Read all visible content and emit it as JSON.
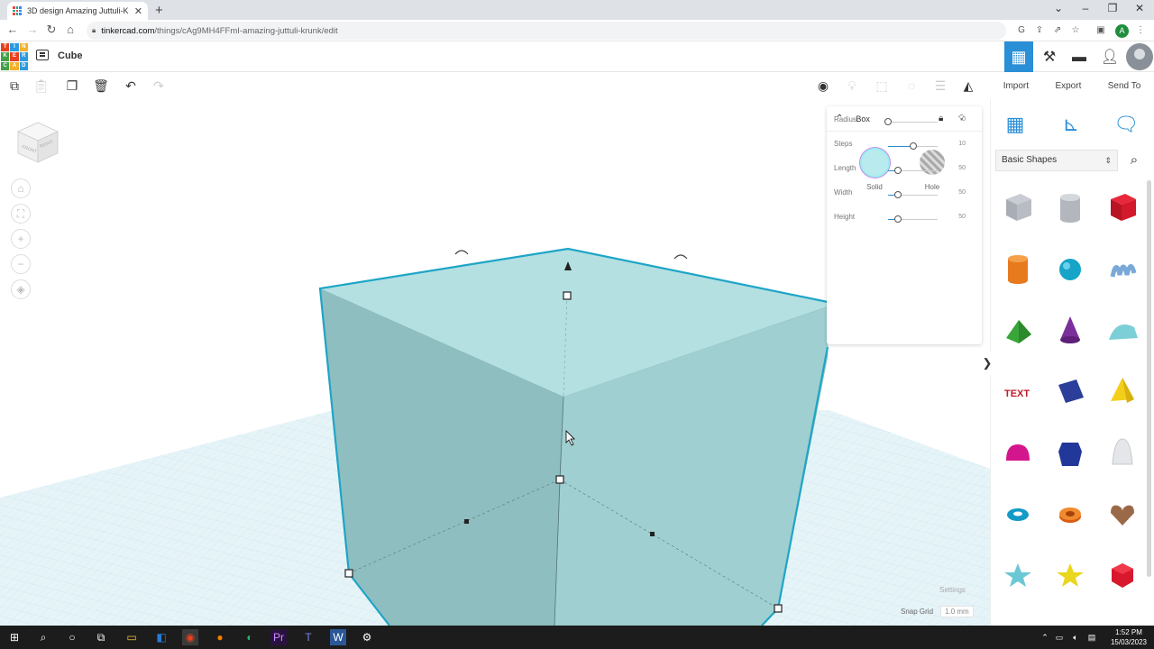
{
  "browser": {
    "tab_title": "3D design Amazing Juttuli-Krunk",
    "tab_close": "✕",
    "new_tab": "+",
    "url_host": "tinkercad.com",
    "url_path": "/things/cAg9MH4FFmI-amazing-juttuli-krunk/edit",
    "profile_initial": "A"
  },
  "header": {
    "logo_letters": [
      "T",
      "I",
      "N",
      "K",
      "E",
      "R",
      "C",
      "A",
      "D"
    ],
    "logo_colors": [
      "#e8411f",
      "#2b9be0",
      "#f3b12b",
      "#43a047",
      "#e8411f",
      "#2b9be0",
      "#43a047",
      "#f3b12b",
      "#2b9be0"
    ],
    "doc_title": "Cube"
  },
  "toolbar": {
    "import_label": "Import",
    "export_label": "Export",
    "sendto_label": "Send To"
  },
  "viewcube": {
    "front_label": "FRONT",
    "right_label": "RIGHT"
  },
  "inspector": {
    "shape_name": "Box",
    "solid_label": "Solid",
    "hole_label": "Hole",
    "solid_color": "#b9ebee",
    "params": [
      {
        "label": "Radius",
        "value": "0",
        "fraction": 0.0
      },
      {
        "label": "Steps",
        "value": "10",
        "fraction": 0.5
      },
      {
        "label": "Length",
        "value": "50",
        "fraction": 0.2
      },
      {
        "label": "Width",
        "value": "50",
        "fraction": 0.2
      },
      {
        "label": "Height",
        "value": "50",
        "fraction": 0.2
      }
    ]
  },
  "library": {
    "selected": "Basic Shapes",
    "shapes": [
      "box-gray",
      "cylinder-gray",
      "box-red",
      "cylinder-orange",
      "sphere-blue",
      "scribble-blue",
      "roof-green",
      "cone-purple",
      "round-roof-teal",
      "text-red",
      "box-blue",
      "pyramid-yellow",
      "half-sphere-magenta",
      "polygon-navy",
      "paraboloid-white",
      "torus-blue",
      "tube-orange",
      "heart-brown",
      "star-teal",
      "star-yellow",
      "icosahedron-red"
    ]
  },
  "workplane": {
    "settings_label": "Settings",
    "snap_grid_label": "Snap Grid",
    "snap_grid_value": "1.0 mm",
    "box_color": "#a9d8da"
  },
  "taskbar": {
    "time": "1:52 PM",
    "date": "15/03/2023"
  }
}
